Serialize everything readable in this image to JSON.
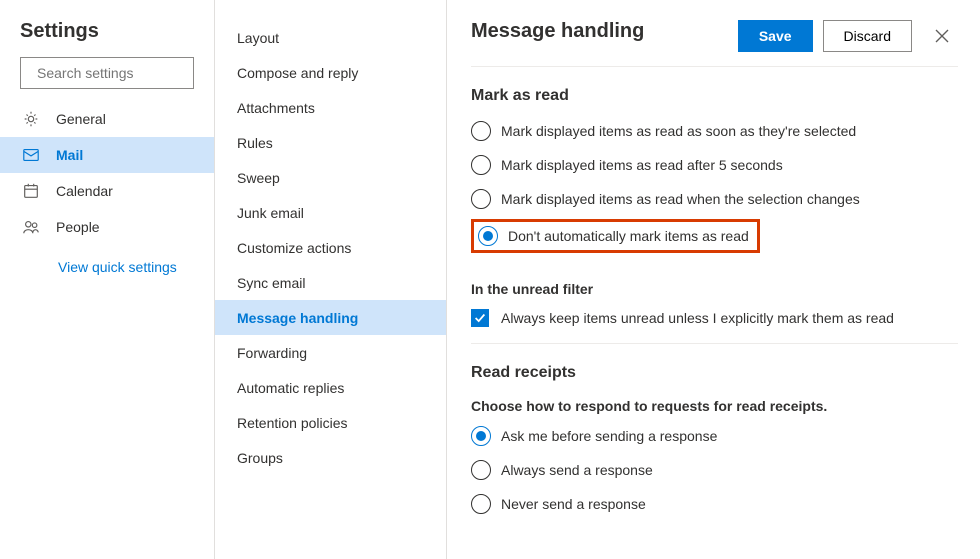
{
  "title": "Settings",
  "search": {
    "placeholder": "Search settings"
  },
  "left_nav": {
    "items": [
      {
        "label": "General"
      },
      {
        "label": "Mail"
      },
      {
        "label": "Calendar"
      },
      {
        "label": "People"
      }
    ],
    "quick_link": "View quick settings"
  },
  "mid_nav": {
    "items": [
      {
        "label": "Layout"
      },
      {
        "label": "Compose and reply"
      },
      {
        "label": "Attachments"
      },
      {
        "label": "Rules"
      },
      {
        "label": "Sweep"
      },
      {
        "label": "Junk email"
      },
      {
        "label": "Customize actions"
      },
      {
        "label": "Sync email"
      },
      {
        "label": "Message handling"
      },
      {
        "label": "Forwarding"
      },
      {
        "label": "Automatic replies"
      },
      {
        "label": "Retention policies"
      },
      {
        "label": "Groups"
      }
    ]
  },
  "right": {
    "title": "Message handling",
    "save": "Save",
    "discard": "Discard",
    "mark_as_read": {
      "title": "Mark as read",
      "opts": [
        "Mark displayed items as read as soon as they're selected",
        "Mark displayed items as read after 5 seconds",
        "Mark displayed items as read when the selection changes",
        "Don't automatically mark items as read"
      ],
      "unread_filter_title": "In the unread filter",
      "unread_filter_opt": "Always keep items unread unless I explicitly mark them as read"
    },
    "read_receipts": {
      "title": "Read receipts",
      "subtitle": "Choose how to respond to requests for read receipts.",
      "opts": [
        "Ask me before sending a response",
        "Always send a response",
        "Never send a response"
      ]
    }
  }
}
